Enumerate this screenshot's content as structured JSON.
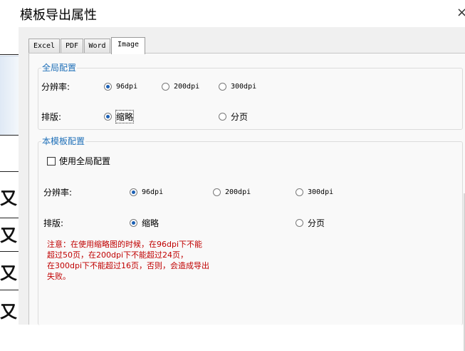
{
  "window": {
    "title": "模板导出属性",
    "close_label": "×"
  },
  "tabs": [
    {
      "label": "Excel",
      "active": false
    },
    {
      "label": "PDF",
      "active": false
    },
    {
      "label": "Word",
      "active": false
    },
    {
      "label": "Image",
      "active": true
    }
  ],
  "global_config": {
    "title": "全局配置",
    "resolution_label": "分辨率:",
    "resolution_options": [
      "96dpi",
      "200dpi",
      "300dpi"
    ],
    "resolution_selected": "96dpi",
    "layout_label": "排版:",
    "layout_options": [
      "缩略",
      "分页"
    ],
    "layout_selected": "缩略"
  },
  "template_config": {
    "title": "本模板配置",
    "use_global_label": "使用全局配置",
    "use_global_checked": false,
    "resolution_label": "分辨率:",
    "resolution_options": [
      "96dpi",
      "200dpi",
      "300dpi"
    ],
    "resolution_selected": "96dpi",
    "layout_label": "排版:",
    "layout_options": [
      "缩略",
      "分页"
    ],
    "layout_selected": "缩略",
    "note": "注意：在使用缩略图的时候，在96dpi下不能\n超过50页，在200dpi下不能超过24页，\n在300dpi下不能超过16页，否则，会造成导出\n失败。"
  },
  "background_doc": {
    "glyphs": [
      "又:",
      "又:",
      "又:",
      "又:"
    ]
  },
  "colors": {
    "group_title": "#1e6fb8",
    "note": "#c00000",
    "radio_dot": "#1a5fb4"
  }
}
